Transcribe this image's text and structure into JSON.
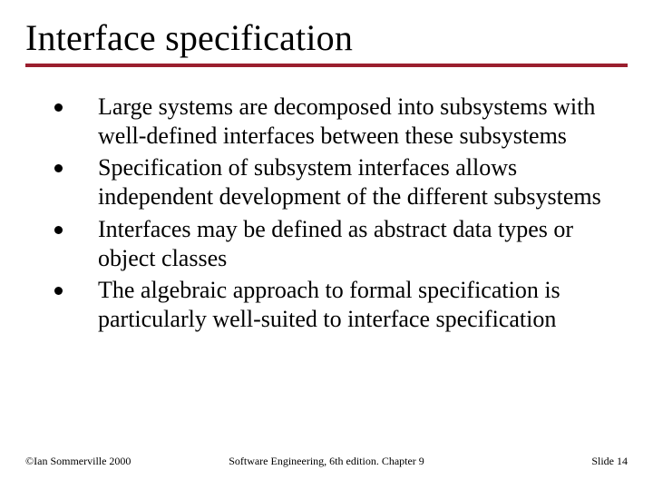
{
  "title": "Interface specification",
  "bullets": [
    "Large systems are decomposed into subsystems with well-defined interfaces between these subsystems",
    "Specification of subsystem interfaces allows independent development of the different subsystems",
    "Interfaces may be defined as abstract data types or object classes",
    "The algebraic approach to formal specification is particularly well-suited to interface specification"
  ],
  "footer": {
    "left": "©Ian Sommerville 2000",
    "center": "Software Engineering, 6th edition. Chapter 9",
    "right": "Slide 14"
  }
}
